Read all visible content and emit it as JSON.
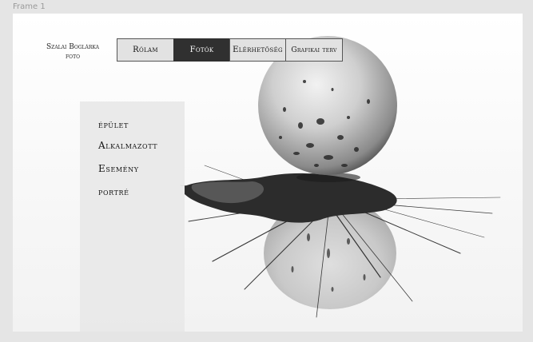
{
  "frame": {
    "label": "Frame 1"
  },
  "brand": {
    "line1": "Szalai Boglárka",
    "line2": "foto"
  },
  "nav": {
    "items": [
      {
        "label": "Rólam"
      },
      {
        "label": "Fotók",
        "active": true
      },
      {
        "label": "Elérhetőség"
      },
      {
        "label": "Grafikai terv"
      }
    ]
  },
  "categories": [
    {
      "label": "épület"
    },
    {
      "label": "Alkalmazott"
    },
    {
      "label": "Esemény"
    },
    {
      "label": "portré"
    }
  ],
  "colors": {
    "page": "#e5e5e5",
    "frame": "#ffffff",
    "nav_active": "#303030",
    "nav_inactive": "#e2e2e2",
    "sidebar": "#e8e8e8"
  },
  "background_image": {
    "subject": "splash-ball-photo"
  }
}
